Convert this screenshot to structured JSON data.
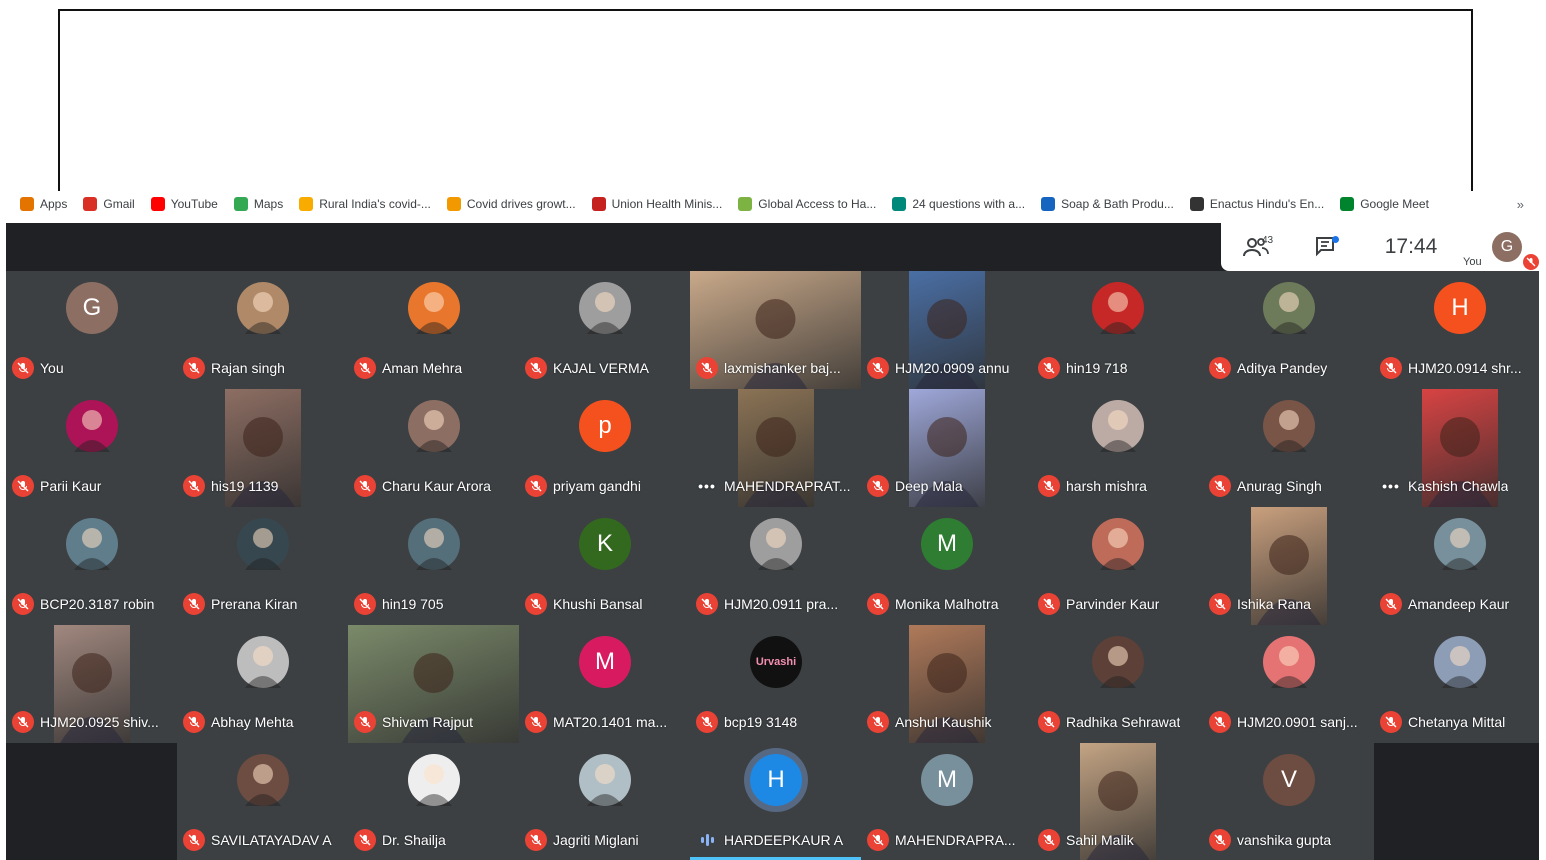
{
  "bookmarks": [
    {
      "label": "Apps",
      "icon": "apps-grid-icon",
      "color": "#e37400"
    },
    {
      "label": "Gmail",
      "icon": "gmail-icon",
      "color": "#d93025"
    },
    {
      "label": "YouTube",
      "icon": "youtube-icon",
      "color": "#ff0000"
    },
    {
      "label": "Maps",
      "icon": "maps-icon",
      "color": "#34a853"
    },
    {
      "label": "Rural India's covid-...",
      "icon": "site-icon",
      "color": "#f9ab00"
    },
    {
      "label": "Covid drives growt...",
      "icon": "site-icon",
      "color": "#f29900"
    },
    {
      "label": "Union Health Minis...",
      "icon": "site-icon",
      "color": "#c5221f"
    },
    {
      "label": "Global Access to Ha...",
      "icon": "site-icon",
      "color": "#7cb342"
    },
    {
      "label": "24 questions with a...",
      "icon": "site-icon",
      "color": "#00897b"
    },
    {
      "label": "Soap & Bath Produ...",
      "icon": "site-icon",
      "color": "#1565c0"
    },
    {
      "label": "Enactus Hindu's En...",
      "icon": "du-icon",
      "color": "#333333"
    },
    {
      "label": "Google Meet",
      "icon": "google-meet-icon",
      "color": "#00832d"
    }
  ],
  "bookmarks_more": "»",
  "header": {
    "participants_count": "43",
    "time": "17:44",
    "self_label": "You",
    "self_initial": "G"
  },
  "participants": [
    {
      "name": "You",
      "kind": "initial",
      "initial": "G",
      "color": "#8d6e63",
      "status": "muted"
    },
    {
      "name": "Rajan singh",
      "kind": "photo",
      "color": "#b08968",
      "status": "muted"
    },
    {
      "name": "Aman Mehra",
      "kind": "photo",
      "color": "#e8762c",
      "status": "muted"
    },
    {
      "name": "KAJAL VERMA",
      "kind": "photo",
      "color": "#9e9e9e",
      "status": "muted"
    },
    {
      "name": "laxmishanker baj...",
      "kind": "video",
      "color": "#c9a98a",
      "status": "muted"
    },
    {
      "name": "HJM20.0909 annu",
      "kind": "video",
      "color": "#4a6fa5",
      "status": "muted"
    },
    {
      "name": "hin19 718",
      "kind": "photo",
      "color": "#c62828",
      "status": "muted"
    },
    {
      "name": "Aditya Pandey",
      "kind": "photo",
      "color": "#6d7b5a",
      "status": "muted"
    },
    {
      "name": "HJM20.0914 shr...",
      "kind": "initial",
      "initial": "H",
      "color": "#f4511e",
      "status": "muted"
    },
    {
      "name": "Parii Kaur",
      "kind": "photo",
      "color": "#ad1457",
      "status": "muted"
    },
    {
      "name": "his19 1139",
      "kind": "video",
      "color": "#8d6e63",
      "status": "muted"
    },
    {
      "name": "Charu Kaur Arora",
      "kind": "photo",
      "color": "#8d6e63",
      "status": "muted"
    },
    {
      "name": "priyam gandhi",
      "kind": "initial",
      "initial": "p",
      "color": "#f4511e",
      "status": "muted"
    },
    {
      "name": "MAHENDRAPRAT...",
      "kind": "video",
      "color": "#8b7355",
      "status": "more"
    },
    {
      "name": "Deep Mala",
      "kind": "video",
      "color": "#9fa8da",
      "status": "muted"
    },
    {
      "name": "harsh mishra",
      "kind": "photo",
      "color": "#bcaaa4",
      "status": "muted"
    },
    {
      "name": "Anurag Singh",
      "kind": "photo",
      "color": "#795548",
      "status": "muted"
    },
    {
      "name": "Kashish Chawla",
      "kind": "video",
      "color": "#d84343",
      "status": "more"
    },
    {
      "name": "BCP20.3187 robin",
      "kind": "photo",
      "color": "#607d8b",
      "status": "muted"
    },
    {
      "name": "Prerana Kiran",
      "kind": "photo",
      "color": "#37474f",
      "status": "muted"
    },
    {
      "name": "hin19 705",
      "kind": "photo",
      "color": "#546e7a",
      "status": "muted"
    },
    {
      "name": "Khushi Bansal",
      "kind": "initial",
      "initial": "K",
      "color": "#33691e",
      "status": "muted"
    },
    {
      "name": "HJM20.0911 pra...",
      "kind": "photo",
      "color": "#9e9e9e",
      "status": "muted"
    },
    {
      "name": "Monika Malhotra",
      "kind": "initial",
      "initial": "M",
      "color": "#2e7d32",
      "status": "muted"
    },
    {
      "name": "Parvinder Kaur",
      "kind": "photo",
      "color": "#bf6b5a",
      "status": "muted"
    },
    {
      "name": "Ishika Rana",
      "kind": "video",
      "color": "#c9a07e",
      "status": "muted"
    },
    {
      "name": "Amandeep Kaur",
      "kind": "photo",
      "color": "#78909c",
      "status": "muted"
    },
    {
      "name": "HJM20.0925 shiv...",
      "kind": "video",
      "color": "#a1887f",
      "status": "muted"
    },
    {
      "name": "Abhay Mehta",
      "kind": "photo",
      "color": "#bdbdbd",
      "status": "muted"
    },
    {
      "name": "Shivam Rajput",
      "kind": "video",
      "color": "#7b8a6a",
      "status": "muted"
    },
    {
      "name": "MAT20.1401 ma...",
      "kind": "initial",
      "initial": "M",
      "color": "#d81b60",
      "status": "muted"
    },
    {
      "name": "bcp19 3148",
      "kind": "logo",
      "logo_text": "Urvashi",
      "color": "#111111",
      "status": "muted"
    },
    {
      "name": "Anshul Kaushik",
      "kind": "video",
      "color": "#b07a5a",
      "status": "muted"
    },
    {
      "name": "Radhika Sehrawat",
      "kind": "photo",
      "color": "#5d4037",
      "status": "muted"
    },
    {
      "name": "HJM20.0901 sanj...",
      "kind": "photo",
      "color": "#e57373",
      "status": "muted"
    },
    {
      "name": "Chetanya Mittal",
      "kind": "photo",
      "color": "#8d9db6",
      "status": "muted"
    },
    {
      "name": "",
      "kind": "empty",
      "status": "none"
    },
    {
      "name": "SAVILATAYADAV A",
      "kind": "photo",
      "color": "#6d4c41",
      "status": "muted"
    },
    {
      "name": "Dr. Shailja",
      "kind": "photo",
      "color": "#eeeeee",
      "status": "muted"
    },
    {
      "name": "Jagriti Miglani",
      "kind": "photo",
      "color": "#b0bec5",
      "status": "muted"
    },
    {
      "name": "HARDEEPKAUR A",
      "kind": "initial",
      "initial": "H",
      "color": "#1e88e5",
      "status": "speaking"
    },
    {
      "name": "MAHENDRAPRA...",
      "kind": "initial",
      "initial": "M",
      "color": "#78909c",
      "status": "muted"
    },
    {
      "name": "Sahil Malik",
      "kind": "video",
      "color": "#c4a484",
      "status": "muted"
    },
    {
      "name": "vanshika gupta",
      "kind": "initial",
      "initial": "V",
      "color": "#6d4c41",
      "status": "muted"
    },
    {
      "name": "",
      "kind": "empty",
      "status": "none"
    }
  ],
  "accent_color": "#ea4335",
  "speaking_color": "#8ab4f8"
}
